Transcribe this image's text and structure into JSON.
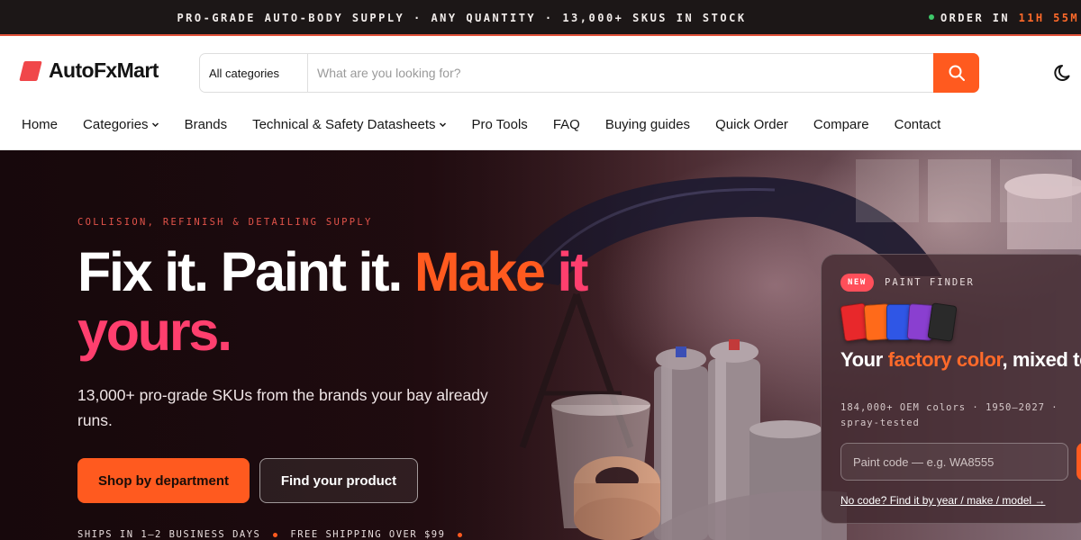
{
  "topbar": {
    "message": "PRO-GRADE AUTO-BODY SUPPLY · ANY QUANTITY · 13,000+ SKUS IN STOCK",
    "order_label": "ORDER IN",
    "countdown": "11H 55M",
    "status_color": "#3ec76a"
  },
  "header": {
    "brand": "AutoFxMart",
    "search": {
      "category": "All categories",
      "placeholder": "What are you looking for?",
      "button_icon": "search-icon"
    },
    "theme_icon": "moon-icon"
  },
  "nav": {
    "items": [
      {
        "label": "Home"
      },
      {
        "label": "Categories",
        "has_dropdown": true
      },
      {
        "label": "Brands"
      },
      {
        "label": "Technical & Safety Datasheets",
        "has_dropdown": true
      },
      {
        "label": "Pro Tools"
      },
      {
        "label": "FAQ"
      },
      {
        "label": "Buying guides"
      },
      {
        "label": "Quick Order"
      },
      {
        "label": "Compare"
      },
      {
        "label": "Contact"
      }
    ]
  },
  "hero": {
    "eyebrow": "COLLISION, REFINISH & DETAILING SUPPLY",
    "headline": {
      "white": "Fix it. Paint it.",
      "orange": "Make",
      "pink": "it yours."
    },
    "subcopy": "13,000+ pro-grade SKUs from the brands your bay already runs.",
    "primary_cta": "Shop by department",
    "secondary_cta": "Find your product",
    "perks": [
      "SHIPS IN 1–2 BUSINESS DAYS",
      "FREE SHIPPING OVER $99"
    ]
  },
  "paint_finder": {
    "badge": "NEW",
    "label": "PAINT FINDER",
    "swatch_colors": [
      "#e8282b",
      "#ff6a1a",
      "#2f56e6",
      "#8a3fd0",
      "#2a2a2a"
    ],
    "title": {
      "pre": "Your",
      "accent": "factory color",
      "post": ", mixed to order"
    },
    "meta": "184,000+ OEM colors · 1950–2027 · spray-tested",
    "input_placeholder": "Paint code — e.g. WA8555",
    "link": "No code? Find it by year / make / model →"
  },
  "colors": {
    "accent": "#ff5a1f",
    "pink": "#ff3f6e",
    "dark": "#1c1717"
  }
}
